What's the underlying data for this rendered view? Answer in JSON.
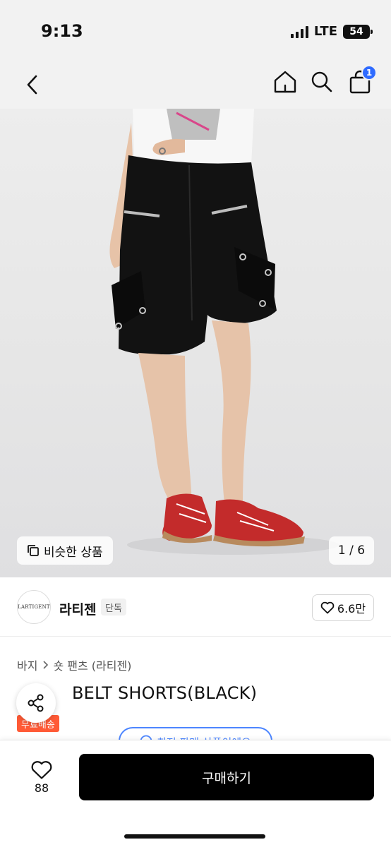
{
  "status_bar": {
    "time": "9:13",
    "network": "LTE",
    "battery": "54"
  },
  "nav": {
    "back_icon": "chevron-left-icon",
    "home_icon": "home-icon",
    "search_icon": "search-icon",
    "cart_icon": "shopping-bag-icon",
    "cart_badge": "1",
    "accent_color": "#2f6bff"
  },
  "hero": {
    "similar_label": "비슷한 상품",
    "page_counter": "1 / 6"
  },
  "shop": {
    "logo_text": "LARTIGENT",
    "name": "라티젠",
    "tag": "단독",
    "likes": "6.6만"
  },
  "product": {
    "breadcrumb": [
      "바지",
      "숏 팬츠 (라티젠)"
    ],
    "title": "BELT SHORTS(BLACK)",
    "free_ship": "무료배송",
    "peek_label": "최저 판매 상품이에요"
  },
  "bottom": {
    "wish_count": "88",
    "buy_label": "구매하기"
  }
}
